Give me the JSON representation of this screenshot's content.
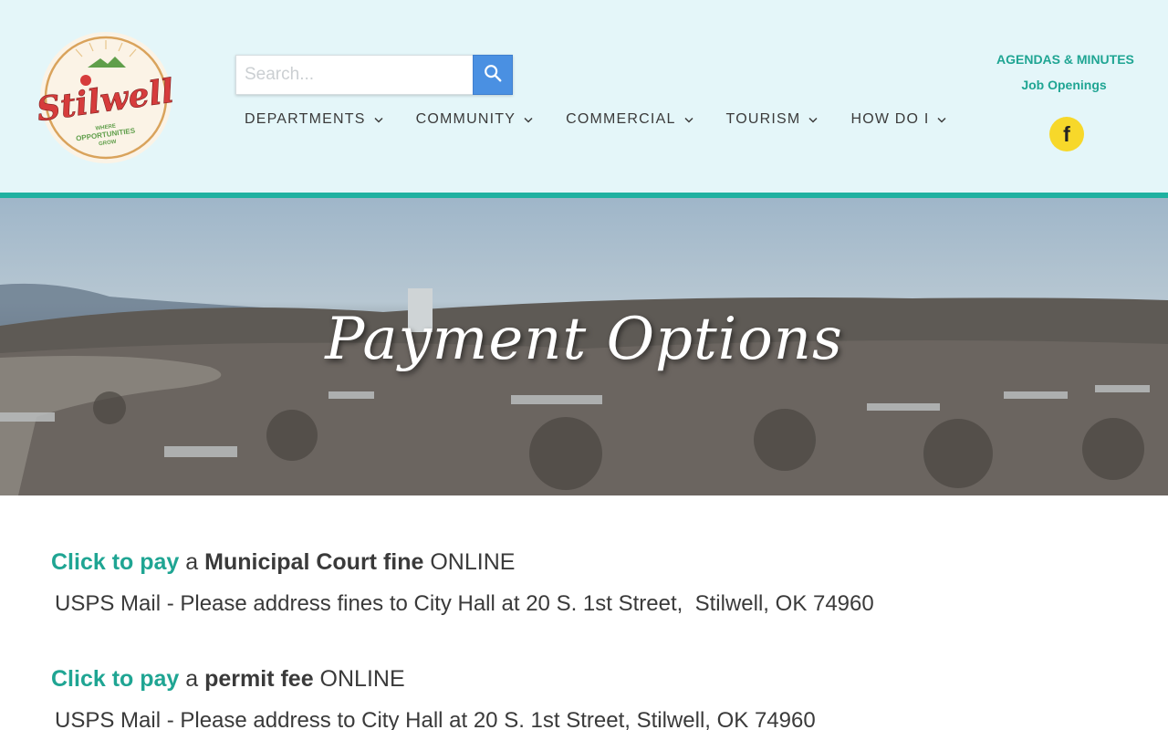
{
  "logo": {
    "name": "Stilwell",
    "tagline_1": "WHERE",
    "tagline_2": "OPPORTUNITIES",
    "tagline_3": "GROW"
  },
  "search": {
    "placeholder": "Search..."
  },
  "nav": {
    "items": [
      {
        "label": "DEPARTMENTS"
      },
      {
        "label": "COMMUNITY"
      },
      {
        "label": "COMMERCIAL"
      },
      {
        "label": "TOURISM"
      },
      {
        "label": "HOW DO I"
      }
    ]
  },
  "top_links": {
    "agendas": "AGENDAS & MINUTES",
    "jobs": "Job Openings"
  },
  "social": {
    "facebook_glyph": "f",
    "icon": "facebook-icon"
  },
  "hero": {
    "title": "Payment Options"
  },
  "content": {
    "court": {
      "link": "Click to pay",
      "a": " a ",
      "strong": "Municipal Court fine",
      "suffix": " ONLINE",
      "mail": "USPS Mail - Please address fines to City Hall at 20 S. 1st Street,  Stilwell, OK 74960"
    },
    "permit": {
      "link": "Click to pay",
      "a": " a ",
      "strong": "permit fee",
      "suffix": " ONLINE",
      "mail": "USPS Mail - Please address to City Hall at 20 S. 1st Street, Stilwell, OK 74960"
    }
  },
  "colors": {
    "accent": "#1fa593",
    "header_bg": "#e4f6f9",
    "header_border": "#1fb1a1",
    "search_button": "#4a90e2",
    "facebook": "#f7d82a",
    "logo_red": "#d63c3c"
  }
}
